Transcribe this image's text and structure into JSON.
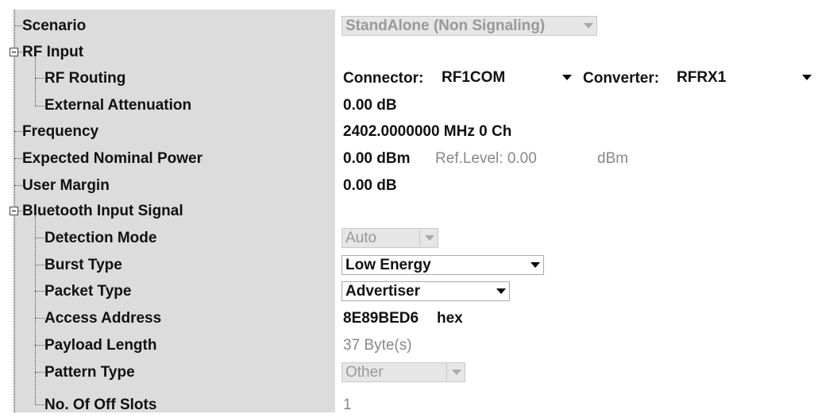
{
  "tree": {
    "scenario": "Scenario",
    "rf_input": "RF Input",
    "rf_routing": "RF Routing",
    "external_attenuation": "External Attenuation",
    "frequency": "Frequency",
    "expected_nominal_power": "Expected Nominal Power",
    "user_margin": "User Margin",
    "bluetooth_input_signal": "Bluetooth Input Signal",
    "detection_mode": "Detection Mode",
    "burst_type": "Burst Type",
    "packet_type": "Packet Type",
    "access_address": "Access Address",
    "payload_length": "Payload Length",
    "pattern_type": "Pattern Type",
    "no_of_off_slots": "No. Of Off Slots"
  },
  "values": {
    "scenario": "StandAlone (Non Signaling)",
    "connector_label": "Connector:",
    "connector_value": "RF1COM",
    "converter_label": "Converter:",
    "converter_value": "RFRX1",
    "external_attenuation": "0.00 dB",
    "frequency": "2402.0000000 MHz 0 Ch",
    "expected_nominal_power": "0.00 dBm",
    "ref_level_label": "Ref.Level: 0.00",
    "ref_level_unit": "dBm",
    "user_margin": "0.00 dB",
    "detection_mode": "Auto",
    "burst_type": "Low Energy",
    "packet_type": "Advertiser",
    "access_address": "8E89BED6",
    "access_address_unit": "hex",
    "payload_length": "37 Byte(s)",
    "pattern_type": "Other",
    "no_of_off_slots": "1"
  },
  "colors": {
    "tree_background": "#dcdcdc",
    "disabled_text": "#888888"
  }
}
